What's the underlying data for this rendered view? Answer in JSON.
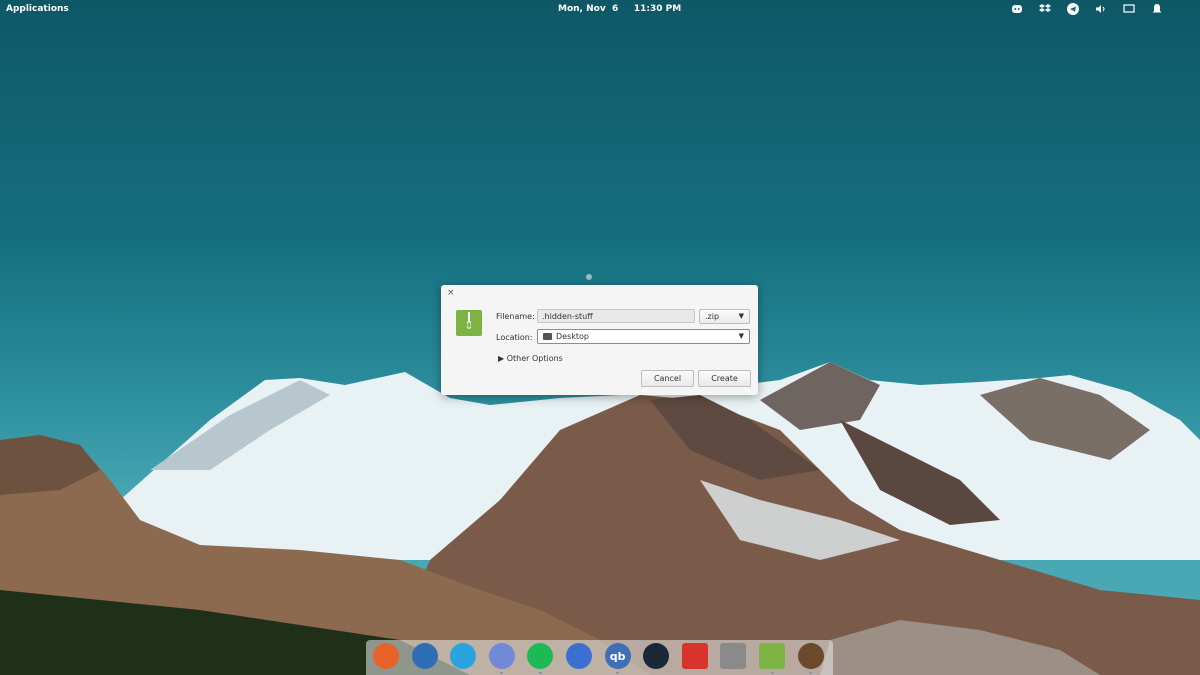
{
  "topbar": {
    "applications_label": "Applications",
    "clock": "Mon, Nov  6     11:30 PM",
    "tray_icons": [
      "discord-icon",
      "dropbox-icon",
      "telegram-icon",
      "volume-icon",
      "display-icon",
      "notifications-icon"
    ]
  },
  "dialog": {
    "close_glyph": "×",
    "filename_label": "Filename:",
    "filename_value": ".hidden-stuff",
    "extension_value": ".zip",
    "location_label": "Location:",
    "location_value": "Desktop",
    "other_options_label": "Other Options",
    "cancel_label": "Cancel",
    "create_label": "Create",
    "icon": "archive-icon"
  },
  "dock": {
    "items": [
      {
        "name": "firefox",
        "color": "#e8632a"
      },
      {
        "name": "thunderbird",
        "color": "#2f6db5"
      },
      {
        "name": "telegram",
        "color": "#2aa3df"
      },
      {
        "name": "discord",
        "color": "#7289da"
      },
      {
        "name": "spotify",
        "color": "#1db954"
      },
      {
        "name": "simplenote",
        "color": "#3b6fd0"
      },
      {
        "name": "qbittorrent",
        "color": "#3f6fb6",
        "glyph": "qb"
      },
      {
        "name": "steam",
        "color": "#1b2838"
      },
      {
        "name": "text-editor",
        "color": "#d9342b"
      },
      {
        "name": "files",
        "color": "#8a8a8a"
      },
      {
        "name": "archive-manager",
        "color": "#7cb342"
      },
      {
        "name": "cheese",
        "color": "#6b4a2b"
      }
    ]
  }
}
